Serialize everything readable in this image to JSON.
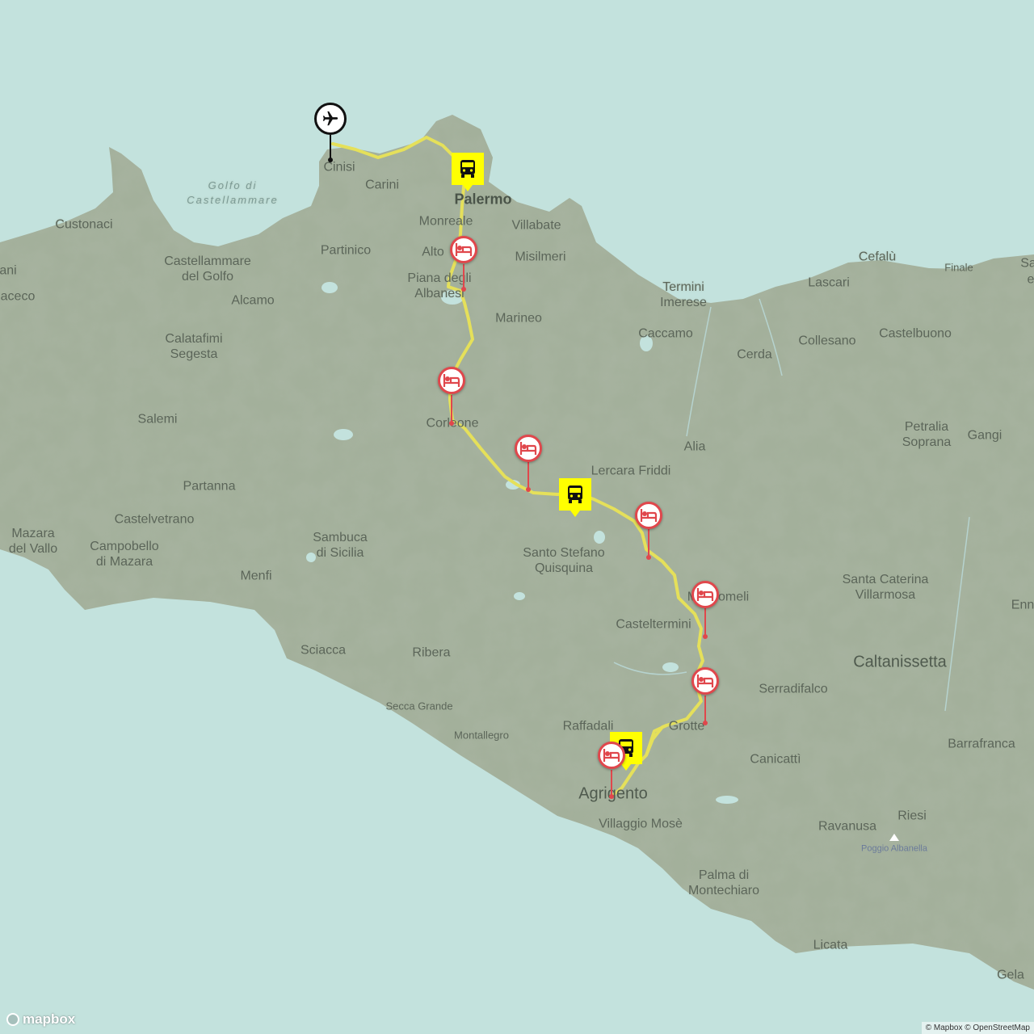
{
  "colors": {
    "sea": "#c3e2dd",
    "land": "#a3b09b",
    "route": "#e5e05a",
    "hotel": "#e0474c",
    "bus": "#ffff00"
  },
  "labels": {
    "cinisi": "Cinisi",
    "carini": "Carini",
    "palermo": "Palermo",
    "monreale": "Monreale",
    "villabate": "Villabate",
    "altofonte": "Alto",
    "misilmeri": "Misilmeri",
    "piana": "Piana degli\nAlbanesi",
    "marineo": "Marineo",
    "custonaci": "Custonaci",
    "castellammare": "Castellammare\ndel Golfo",
    "partinico": "Partinico",
    "alcamo": "Alcamo",
    "ani": "ani",
    "aceco": "aceco",
    "calatafimi": "Calatafimi\nSegesta",
    "salemi": "Salemi",
    "partanna": "Partanna",
    "castelvetrano": "Castelvetrano",
    "mazara": "Mazara\ndel Vallo",
    "campobello": "Campobello\ndi Mazara",
    "sambuca": "Sambuca\ndi Sicilia",
    "menfi": "Menfi",
    "sciacca": "Sciacca",
    "ribera": "Ribera",
    "secca": "Secca Grande",
    "montallegro": "Montallegro",
    "raffadali": "Raffadali",
    "agrigento": "Agrigento",
    "villaggio": "Villaggio Mosè",
    "corleone": "Corleone",
    "santostefano": "Santo Stefano\nQuisquina",
    "lercara": "Lercara Friddi",
    "alia": "Alia",
    "mussomeli": "Mussomeli",
    "casteltermini": "Casteltermini",
    "grotte": "Grotte",
    "serradifalco": "Serradifalco",
    "canicatti": "Canicattì",
    "caltanissetta": "Caltanissetta",
    "termini": "Termini\nImerese",
    "caccamo": "Caccamo",
    "cerda": "Cerda",
    "cefalu": "Cefalù",
    "lascari": "Lascari",
    "finale": "Finale",
    "collesano": "Collesano",
    "castelbuono": "Castelbuono",
    "petralia": "Petralia\nSoprana",
    "gangi": "Gangi",
    "santacaterina": "Santa Caterina\nVillarmosa",
    "enn": "Enn",
    "barrafranca": "Barrafranca",
    "riesi": "Riesi",
    "ravanusa": "Ravanusa",
    "poggio": "Poggio Albanella",
    "palma": "Palma di\nMontechiaro",
    "licata": "Licata",
    "gela": "Gela",
    "sa": "Sa",
    "e": "e",
    "golfo": "Golfo di\nCastellammare"
  },
  "branding": {
    "logo": "mapbox",
    "attribution": "© Mapbox © OpenStreetMap"
  },
  "icons": {
    "airport": "airplane-icon",
    "bus": "bus-icon",
    "hotel": "bed-icon"
  }
}
